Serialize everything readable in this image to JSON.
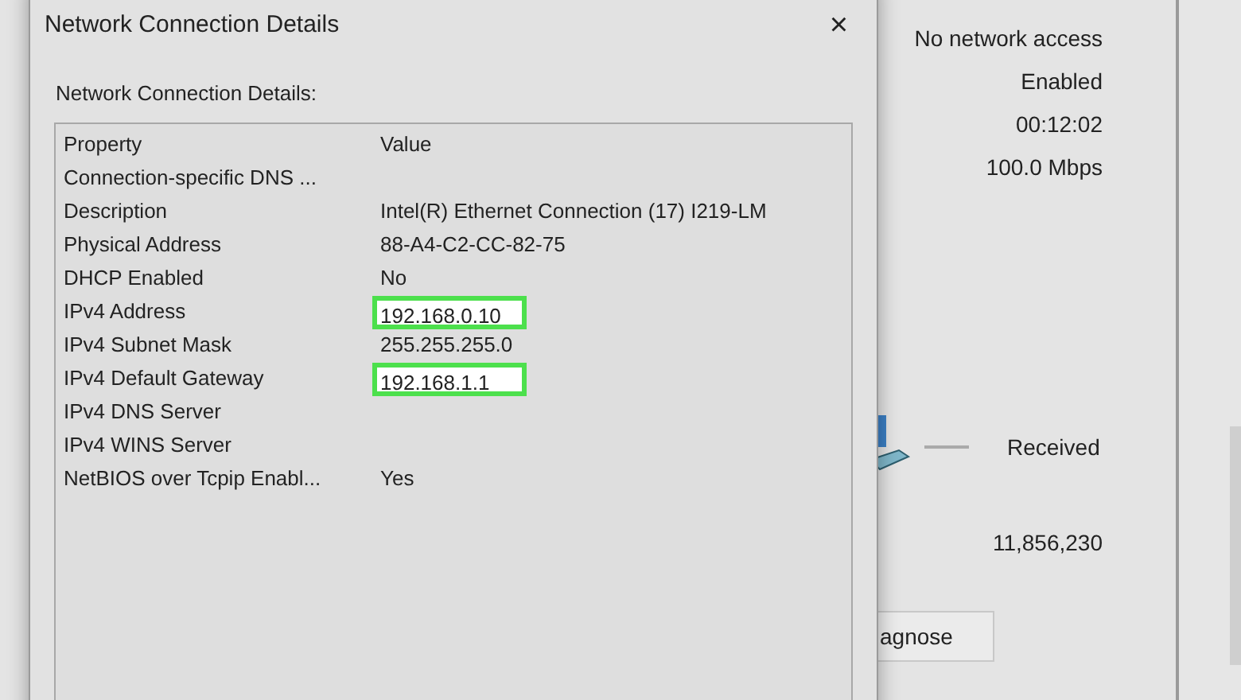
{
  "background_window": {
    "values": [
      "No network access",
      "Enabled",
      "00:12:02",
      "100.0 Mbps"
    ],
    "activity": {
      "label": "Received",
      "value": "11,856,230"
    },
    "button": "agnose"
  },
  "dialog": {
    "title": "Network Connection Details",
    "close": "×",
    "group_label": "Network Connection Details:",
    "columns": [
      "Property",
      "Value"
    ],
    "rows": [
      {
        "property": "Connection-specific DNS ...",
        "value": "",
        "highlighted": false
      },
      {
        "property": "Description",
        "value": "Intel(R) Ethernet Connection (17) I219-LM",
        "highlighted": false
      },
      {
        "property": "Physical Address",
        "value": "88-A4-C2-CC-82-75",
        "highlighted": false
      },
      {
        "property": "DHCP Enabled",
        "value": "No",
        "highlighted": false
      },
      {
        "property": "IPv4 Address",
        "value": "192.168.0.10",
        "highlighted": true
      },
      {
        "property": "IPv4 Subnet Mask",
        "value": "255.255.255.0",
        "highlighted": false
      },
      {
        "property": "IPv4 Default Gateway",
        "value": "192.168.1.1",
        "highlighted": true
      },
      {
        "property": "IPv4 DNS Server",
        "value": "",
        "highlighted": false
      },
      {
        "property": "IPv4 WINS Server",
        "value": "",
        "highlighted": false
      },
      {
        "property": "NetBIOS over Tcpip Enabl...",
        "value": "Yes",
        "highlighted": false
      }
    ]
  }
}
